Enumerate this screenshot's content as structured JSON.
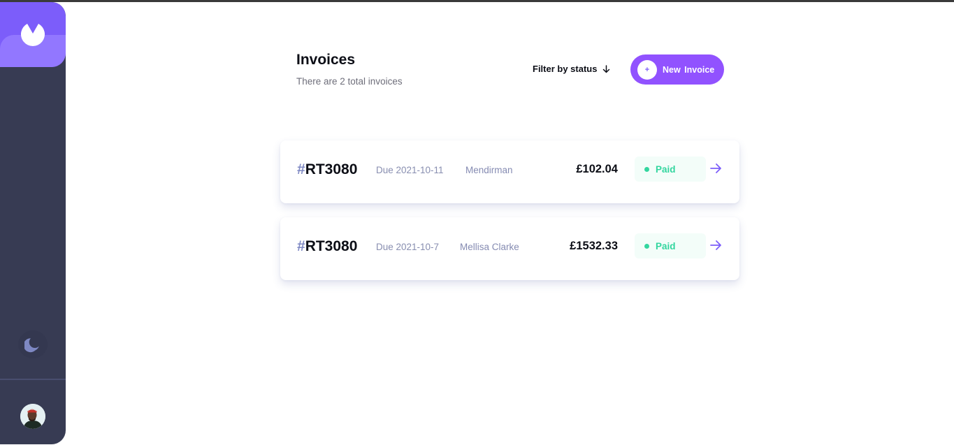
{
  "sidebar": {
    "logo_icon": "brand-logo-icon",
    "theme_icon": "moon-icon",
    "avatar_icon": "user-avatar"
  },
  "header": {
    "title": "Invoices",
    "subtitle": "There are 2 total invoices",
    "filter_label": "Filter by status",
    "filter_icon": "arrow-down-icon",
    "new_button_label": "New  Invoice",
    "new_button_icon": "+"
  },
  "invoices": [
    {
      "hash": "#",
      "id": "RT3080",
      "due": "Due 2021-10-11",
      "client": "Mendirman",
      "amount": "£102.04",
      "status": "Paid"
    },
    {
      "hash": "#",
      "id": "RT3080",
      "due": "Due 2021-10-7",
      "client": "Mellisa Clarke",
      "amount": "£1532.33",
      "status": "Paid"
    }
  ],
  "colors": {
    "accent": "#7c5dfa",
    "button": "#9152ff",
    "sidebar": "#373b53",
    "paid": "#33d69f"
  }
}
